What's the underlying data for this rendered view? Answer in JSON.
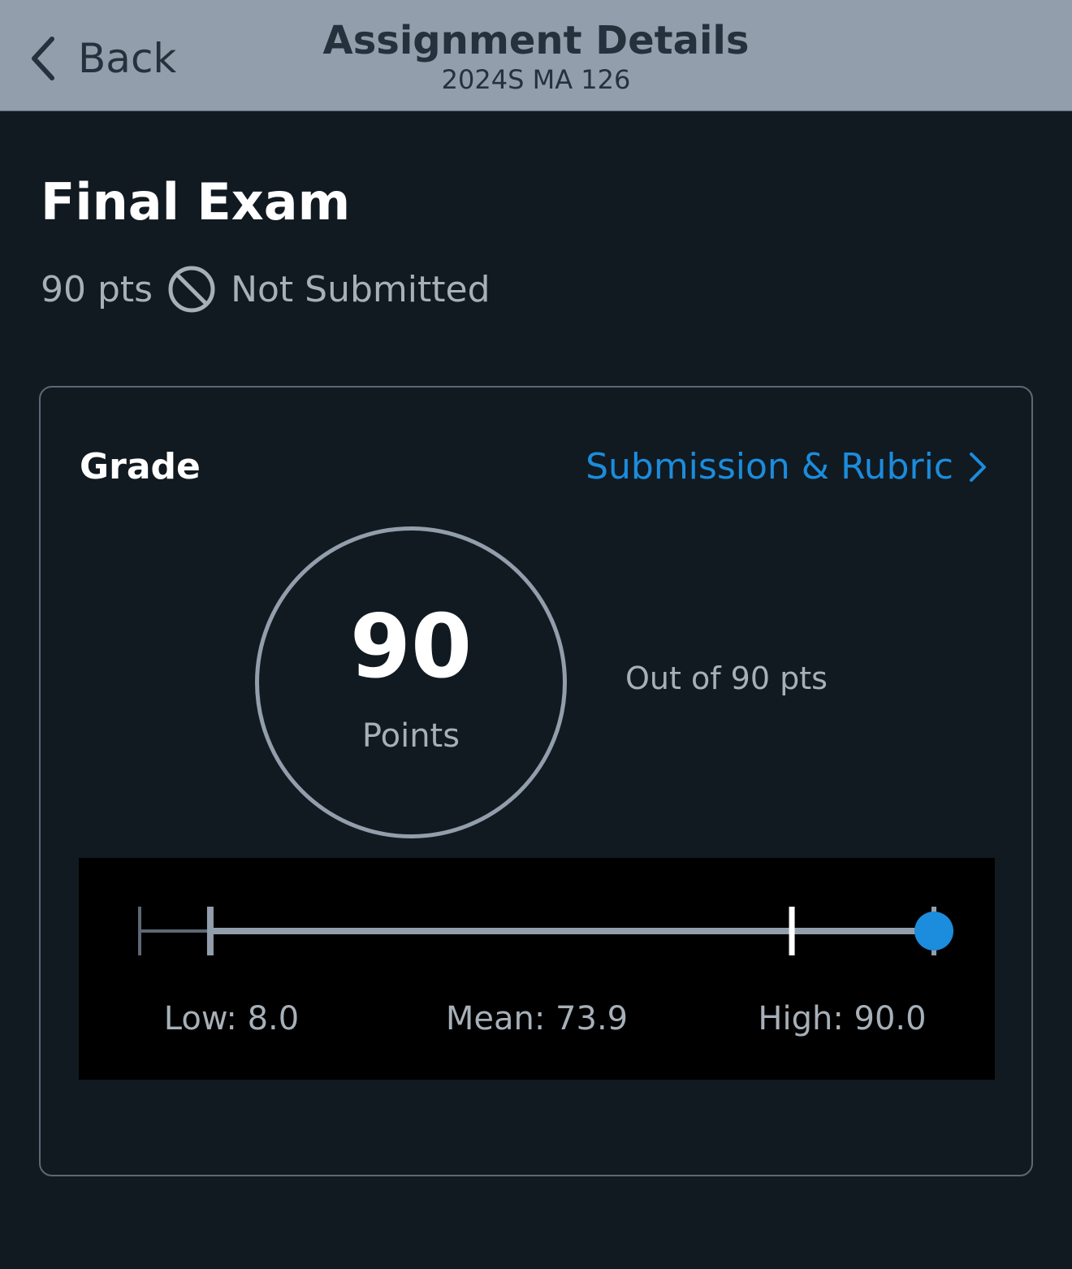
{
  "header": {
    "back_label": "Back",
    "title": "Assignment Details",
    "subtitle": "2024S MA 126"
  },
  "assignment": {
    "title": "Final Exam",
    "points": "90 pts",
    "submission_status": "Not Submitted"
  },
  "grade": {
    "label": "Grade",
    "link_label": "Submission & Rubric",
    "score": "90",
    "score_unit": "Points",
    "out_of": "Out of 90 pts",
    "stats": {
      "low_label": "Low: 8.0",
      "mean_label": "Mean: 73.9",
      "high_label": "High: 90.0",
      "low": 8.0,
      "mean": 73.9,
      "high": 90.0,
      "min": 0,
      "max": 90,
      "score_value": 90
    }
  },
  "colors": {
    "header_bg": "#929eab",
    "page_bg": "#111a21",
    "accent": "#1c8cdc",
    "muted_text": "#a7b0b8",
    "border": "#5d6874"
  },
  "icons": {
    "back": "chevron-left-icon",
    "status": "no-entry-icon",
    "link": "chevron-right-icon"
  }
}
